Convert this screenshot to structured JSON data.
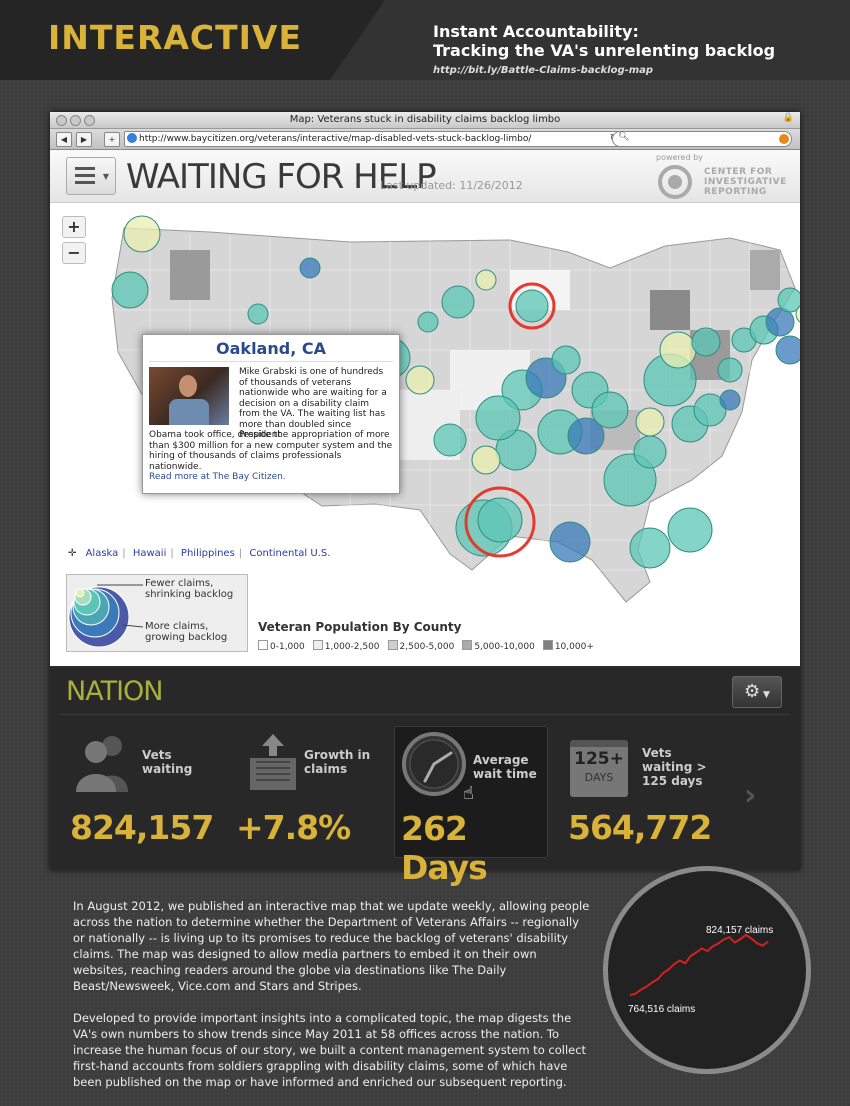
{
  "header": {
    "title": "INTERACTIVE",
    "subtitle_line1": "Instant Accountability:",
    "subtitle_line2": "Tracking the VA's unrelenting backlog",
    "url": "http://bit.ly/Battle-Claims-backlog-map"
  },
  "browser": {
    "window_title": "Map: Veterans stuck in disability claims backlog limbo",
    "address": "http://www.baycitizen.org/veterans/interactive/map-disabled-vets-stuck-backlog-limbo/",
    "back_label": "◀",
    "forward_label": "▶",
    "add_label": "+",
    "reload_label": "↻",
    "search_placeholder": ""
  },
  "app": {
    "title": "WAITING FOR HELP",
    "last_updated": "Last updated: 11/26/2012",
    "powered_by": "powered by",
    "org_line1": "CENTER FOR",
    "org_line2": "INVESTIGATIVE",
    "org_line3": "REPORTING",
    "zoom_in": "+",
    "zoom_out": "−"
  },
  "popup": {
    "place": "Oakland, CA",
    "text_part1": "Mike Grabski is one of hundreds of thousands of veterans nationwide who are waiting for a decision on a disability claim from the VA. The waiting list has more than doubled since President",
    "text_part2": "Obama took office, despite the appropriation of more than $300 million for a new computer system and the hiring of thousands of claims professionals nationwide.",
    "link": "Read more at The Bay Citizen."
  },
  "regions": [
    "Alaska",
    "Hawaii",
    "Philippines",
    "Continental U.S."
  ],
  "legend": {
    "fewer_line1": "Fewer claims,",
    "fewer_line2": "shrinking backlog",
    "more_line1": "More claims,",
    "more_line2": "growing backlog",
    "population_title": "Veteran Population By County",
    "population_bins": [
      {
        "label": "0-1,000",
        "color": "#ffffff"
      },
      {
        "label": "1,000-2,500",
        "color": "#eeeeee"
      },
      {
        "label": "2,500-5,000",
        "color": "#cfcfcf"
      },
      {
        "label": "5,000-10,000",
        "color": "#aaaaaa"
      },
      {
        "label": "10,000+",
        "color": "#7f7f7f"
      }
    ]
  },
  "nation": {
    "title": "NATION",
    "settings_icon": "gear-icon",
    "stats": [
      {
        "label_line1": "Vets",
        "label_line2": "waiting",
        "label_line3": "",
        "value": "824,157",
        "icon": "people-icon"
      },
      {
        "label_line1": "Growth in",
        "label_line2": "claims",
        "label_line3": "",
        "value": "+7.8%",
        "icon": "inbox-tray-icon"
      },
      {
        "label_line1": "Average",
        "label_line2": "wait time",
        "label_line3": "",
        "value": "262 Days",
        "icon": "clock-icon"
      },
      {
        "label_line1": "Vets",
        "label_line2": "waiting >",
        "label_line3": "125 days",
        "value": "564,772",
        "icon": "calendar-icon"
      }
    ],
    "calendar_big": "125+",
    "calendar_small": "DAYS"
  },
  "article": {
    "p1": "In August 2012, we published an interactive map that we update weekly, allowing people across the nation to determine whether the Department of Veterans Affairs -- regionally or nationally -- is living up to its promises to reduce the backlog of veterans' disability claims. The map was designed to allow media partners to embed it on their own websites, reaching readers around the globe via destinations like The Daily Beast/Newsweek, Vice.com and Stars and Stripes.",
    "p2": "Developed to provide important insights into a complicated topic, the map digests the VA's own numbers to show trends since May 2011 at 58 offices across the nation. To increase the human focus of our story, we built a content management system to collect first-hand accounts from soldiers grappling with disability claims, some of which have been published on the map or have informed and enriched our subsequent reporting."
  },
  "sparkline": {
    "start_label": "764,516 claims",
    "end_label": "824,157 claims",
    "line_color": "#d42020",
    "values": [
      764516,
      766000,
      770500,
      774000,
      778500,
      782000,
      789000,
      793000,
      799000,
      803000,
      800000,
      808000,
      812000,
      816500,
      813500,
      819000,
      822000,
      826500,
      829000,
      823000,
      827000,
      831500,
      827500,
      822500,
      819500,
      824157
    ]
  },
  "colors": {
    "accent_gold": "#d9b23a",
    "nation_green": "#a6b13c",
    "bubble_teal": "#5cc6b6",
    "bubble_blue": "#3a7ab8",
    "highlight_red": "#e53a30"
  }
}
